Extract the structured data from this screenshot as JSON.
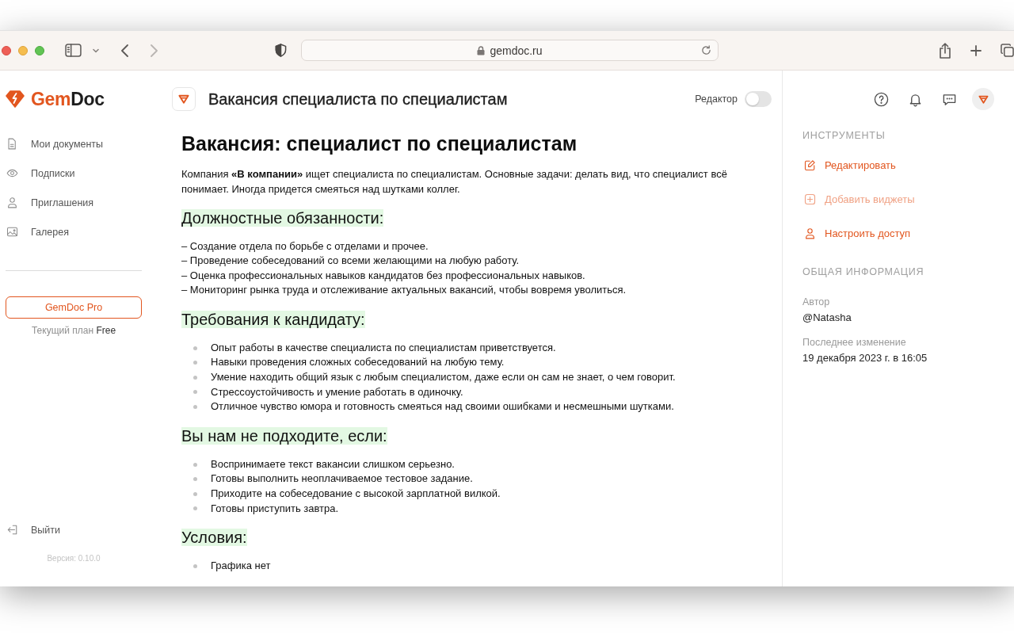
{
  "browser": {
    "nav_buttons": [
      {
        "kind": "back",
        "disabled": false
      },
      {
        "kind": "forward",
        "disabled": true
      }
    ],
    "address": "gemdoc.ru"
  },
  "sidebar": {
    "logo": {
      "accent": "Gem",
      "rest": "Doc"
    },
    "items": [
      {
        "label": "Мои документы"
      },
      {
        "label": "Подписки"
      },
      {
        "label": "Приглашения"
      },
      {
        "label": "Галерея"
      }
    ],
    "pro_button": "GemDoc Pro",
    "plan": {
      "label": "Текущий план",
      "value": "Free"
    },
    "logout": "Выйти",
    "version": "Версия: 0.10.0"
  },
  "document": {
    "title": "Вакансия специалиста по специалистам",
    "editor_toggle": {
      "label": "Редактор",
      "on": false
    },
    "heading": "Вакансия: специалист по специалистам",
    "intro": "Компания **«В компании»** ищет специалиста по специалистам. Основные задачи: делать вид, что специалист всё понимает. Иногда придется смеяться над шутками коллег.",
    "sections": [
      {
        "heading": "Должностные обязанности:",
        "kind": "dash",
        "items": [
          "– Создание отдела по борьбе с отделами и прочее.",
          "– Проведение собеседований со всеми желающими на любую работу.",
          "– Оценка профессиональных навыков кандидатов без профессиональных навыков.",
          "– Мониторинг рынка труда и отслеживание актуальных вакансий, чтобы вовремя уволиться."
        ]
      },
      {
        "heading": "Требования к кандидату:",
        "kind": "bullet",
        "items": [
          "Опыт работы в качестве специалиста по специалистам приветствуется.",
          "Навыки проведения сложных собеседований на любую тему.",
          "Умение находить общий язык с любым специалистом, даже если он сам не знает, о чем говорит.",
          "Стрессоустойчивость и умение работать в одиночку.",
          "Отличное чувство юмора и готовность смеяться над своими ошибками и несмешными шутками."
        ]
      },
      {
        "heading": "Вы нам не подходите, если:",
        "kind": "bullet",
        "items": [
          "Воспринимаете текст вакансии слишком серьезно.",
          "Готовы выполнить неоплачиваемое тестовое задание.",
          "Приходите на собеседование с высокой зарплатной вилкой.",
          "Готовы приступить завтра."
        ]
      },
      {
        "heading": "Условия:",
        "kind": "bullet",
        "items": [
          "Графика нет"
        ]
      }
    ]
  },
  "panel": {
    "tools_title": "ИНСТРУМЕНТЫ",
    "tools": [
      {
        "label": "Редактировать",
        "disabled": false
      },
      {
        "label": "Добавить виджеты",
        "disabled": true
      },
      {
        "label": "Настроить доступ",
        "disabled": false
      }
    ],
    "info_title": "ОБЩАЯ ИНФОРМАЦИЯ",
    "info": [
      {
        "label": "Автор",
        "value": "@Natasha"
      },
      {
        "label": "Последнее изменение",
        "value": "19 декабря 2023 г. в 16:05"
      }
    ]
  }
}
